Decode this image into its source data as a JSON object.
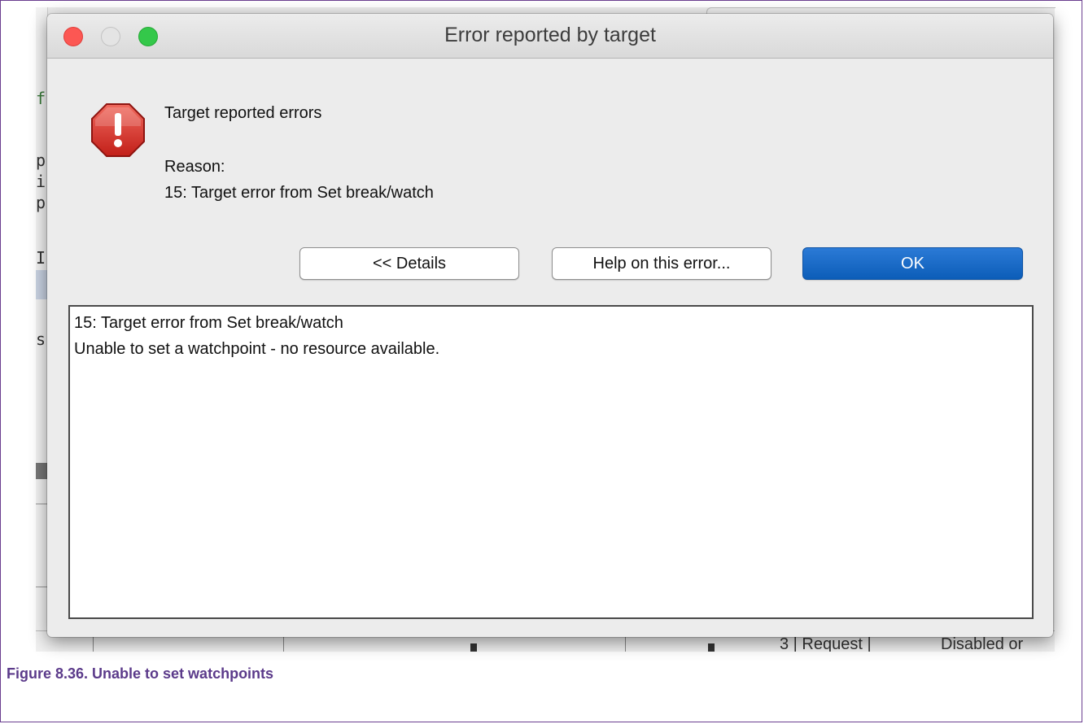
{
  "dialog": {
    "title": "Error reported by target",
    "heading": "Target reported errors",
    "reason_label": "Reason:",
    "reason_text": "15: Target error from Set break/watch",
    "buttons": {
      "details": "<< Details",
      "help": "Help on this error...",
      "ok": "OK"
    },
    "details_lines": [
      "15: Target error from Set break/watch",
      "Unable to set a watchpoint - no resource available."
    ],
    "icon": "alert-icon"
  },
  "background": {
    "left_chars": [
      "f",
      "p",
      "i",
      "p",
      "I",
      "s"
    ],
    "bottom_text_1": "3 | Request |",
    "bottom_text_2": "Disabled or"
  },
  "caption": "Figure 8.36. Unable to set watchpoints",
  "colors": {
    "ok_button": "#0c5db8",
    "caption": "#5b3a8a",
    "close": "#fc5753",
    "zoom": "#34c84a",
    "alert": "#d0302a"
  }
}
